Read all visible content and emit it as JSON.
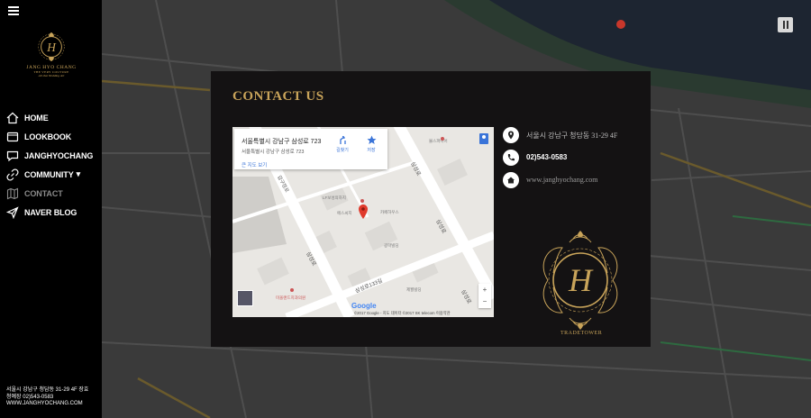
{
  "sidebar": {
    "brand": {
      "name": "JANG HYO CHANG",
      "tagline": "THE VERY COUTURE",
      "script": "All that Wedding Art",
      "monogram": "H"
    },
    "nav": [
      {
        "label": "HOME",
        "icon": "home-icon"
      },
      {
        "label": "LOOKBOOK",
        "icon": "book-icon"
      },
      {
        "label": "JANGHYOCHANG",
        "icon": "chat-icon"
      },
      {
        "label": "COMMUNITY",
        "icon": "link-icon",
        "caret": "▾"
      },
      {
        "label": "CONTACT",
        "icon": "map-icon"
      },
      {
        "label": "NAVER BLOG",
        "icon": "send-icon"
      }
    ],
    "footer": {
      "address": "서울시 강남구 청담동 31-29 4F 장효",
      "phone": "청예장 02)543-0583",
      "website": "WWW.JANGHYOCHANG.COM"
    }
  },
  "modal": {
    "title": "CONTACT US",
    "map_card": {
      "address": "서울특별시 강남구 삼성로 723",
      "sub_address": "서울특별시 강남구 삼성로 723",
      "larger_map_link": "큰 지도 보기",
      "directions_label": "길찾기",
      "save_label": "저장"
    },
    "map_labels": {
      "road1": "삼성로",
      "road2": "삼성로133길",
      "road3": "압구정로",
      "place1": "LF보성의하지",
      "place2": "카페하우스",
      "place3": "불스파이어",
      "place4": "미올랜드치과의원",
      "place5": "제월빌딩",
      "place6": "에스씨지",
      "place7": "광학빌딩",
      "google": "Google",
      "attribution": "©2017 Google - 지도 데이터 ©2017 SK telecom 이용약관"
    },
    "zoom_in": "+",
    "zoom_out": "−",
    "contact": {
      "address": "서울시 강남구 청담동 31-29 4F",
      "phone": "02)543-0583",
      "website": "www.janghyochang.com"
    },
    "emblem": {
      "monogram": "H",
      "caption": "TRADETOWER"
    }
  },
  "colors": {
    "gold": "#c9a45a",
    "sidebar": "#000000",
    "modal": "#141213",
    "link_blue": "#3a74d8",
    "pin_red": "#e03a2c"
  }
}
